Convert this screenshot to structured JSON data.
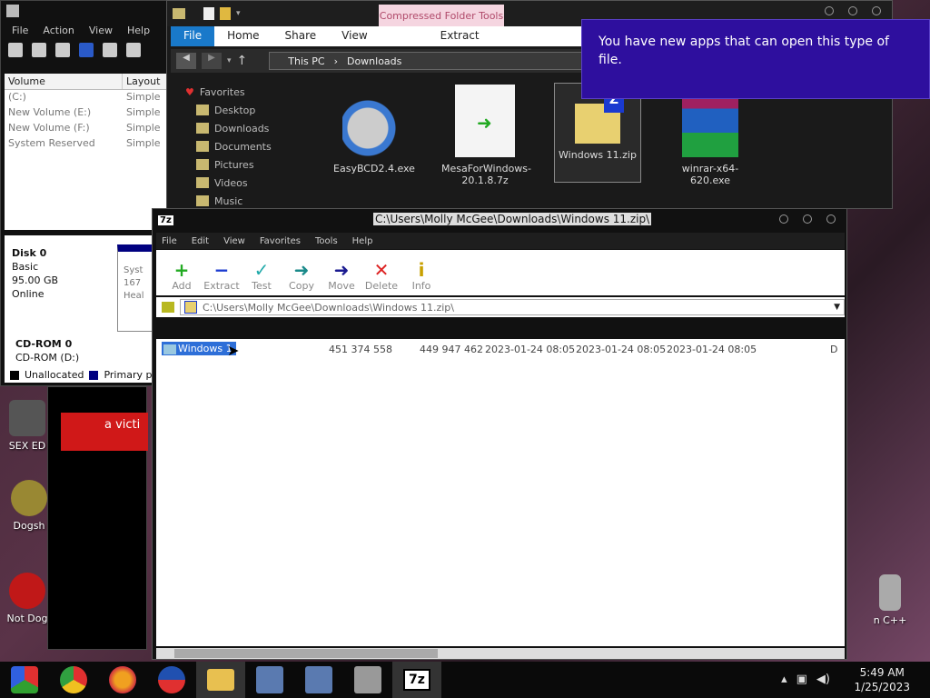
{
  "desktop": {
    "icons": [
      {
        "label": "SEX ED"
      },
      {
        "label": "Dogsh"
      },
      {
        "label": "Not Dog"
      },
      {
        "label": "n C++"
      }
    ],
    "red_banner_text": "a victi"
  },
  "disk_management": {
    "menu": [
      "File",
      "Action",
      "View",
      "Help"
    ],
    "columns": [
      "Volume",
      "Layout"
    ],
    "volumes": [
      {
        "name": "(C:)",
        "layout": "Simple"
      },
      {
        "name": "New Volume (E:)",
        "layout": "Simple"
      },
      {
        "name": "New Volume (F:)",
        "layout": "Simple"
      },
      {
        "name": "System Reserved",
        "layout": "Simple"
      }
    ],
    "disk0": {
      "title": "Disk 0",
      "type": "Basic",
      "size": "95.00 GB",
      "status": "Online",
      "part_label": "Syst",
      "part_size": "167",
      "part_status": "Heal"
    },
    "cdrom": {
      "title": "CD-ROM 0",
      "drive": "CD-ROM (D:)"
    },
    "legend": [
      {
        "label": "Unallocated",
        "color": "#000000"
      },
      {
        "label": "Primary p",
        "color": "#000080"
      }
    ]
  },
  "explorer": {
    "context_tab": "Compressed Folder Tools",
    "ribbon": [
      "File",
      "Home",
      "Share",
      "View",
      "Extract"
    ],
    "breadcrumb": [
      "This PC",
      "Downloads"
    ],
    "nav": {
      "header": "Favorites",
      "items": [
        "Desktop",
        "Downloads",
        "Documents",
        "Pictures",
        "Videos",
        "Music"
      ]
    },
    "files": [
      {
        "name": "EasyBCD2.4.exe"
      },
      {
        "name": "MesaForWindows-20.1.8.7z"
      },
      {
        "name": "Windows 11.zip"
      },
      {
        "name": "winrar-x64-620.exe"
      }
    ]
  },
  "toast": {
    "message": "You have new apps that can open this type of file."
  },
  "sevenzip": {
    "app_badge": "7z",
    "title": "C:\\Users\\Molly McGee\\Downloads\\Windows 11.zip\\",
    "menu": [
      "File",
      "Edit",
      "View",
      "Favorites",
      "Tools",
      "Help"
    ],
    "toolbar": [
      {
        "label": "Add",
        "glyph": "+",
        "color": "#22aa22"
      },
      {
        "label": "Extract",
        "glyph": "−",
        "color": "#1a3ad0"
      },
      {
        "label": "Test",
        "glyph": "✓",
        "color": "#22aaaa"
      },
      {
        "label": "Copy",
        "glyph": "➜",
        "color": "#1a8a8a"
      },
      {
        "label": "Move",
        "glyph": "➜",
        "color": "#1a1a90"
      },
      {
        "label": "Delete",
        "glyph": "✕",
        "color": "#dd2222"
      },
      {
        "label": "Info",
        "glyph": "i",
        "color": "#c8a000"
      }
    ],
    "path": "C:\\Users\\Molly McGee\\Downloads\\Windows 11.zip\\",
    "rows": [
      {
        "name": "Windows 1",
        "size": "451 374 558",
        "packed": "449 947 462",
        "modified": "2023-01-24 08:05",
        "created": "2023-01-24 08:05",
        "accessed": "2023-01-24 08:05",
        "attr": "D"
      }
    ]
  },
  "taskbar": {
    "time": "5:49 AM",
    "date": "1/25/2023",
    "active_app": "7z"
  }
}
